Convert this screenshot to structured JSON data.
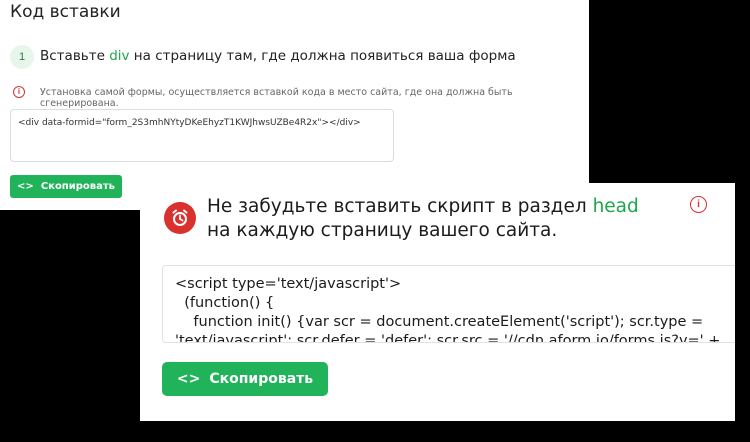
{
  "back_panel": {
    "title": "Код вставки",
    "step_number": "1",
    "step_text_before": "Вставьте ",
    "step_text_highlight": "div",
    "step_text_after": " на страницу там, где должна появиться ваша форма",
    "info_text": "Установка самой формы, осуществляется вставкой кода в место сайта, где она должна быть сгенерирована.",
    "code_snippet": "<div data-formid=\"form_2S3mhNYtyDKeEhyzT1KWJhwsUZBe4R2x\"></div>",
    "copy_button_icon": "<>",
    "copy_button_label": "Скопировать"
  },
  "front_card": {
    "notice_before": "Не забудьте вставить скрипт в раздел ",
    "notice_highlight": "head",
    "notice_after": " на каждую страницу вашего сайта.",
    "code_snippet": "<script type='text/javascript'>\n  (function() {\n    function init() {var scr = document.createElement('script'); scr.type =\n'text/javascript'; scr.defer = 'defer'; scr.src = '//cdn.aform.io/forms.js?v=' +",
    "copy_button_icon": "<>",
    "copy_button_label": "Скопировать"
  },
  "icons": {
    "clock": "alarm-clock-icon",
    "info": "info-icon",
    "code": "code-brackets-icon"
  },
  "colors": {
    "accent_green": "#21b35a",
    "highlight_green": "#1ea64a",
    "alert_red": "#d9312e",
    "step_badge_bg": "#e6f6ea"
  }
}
